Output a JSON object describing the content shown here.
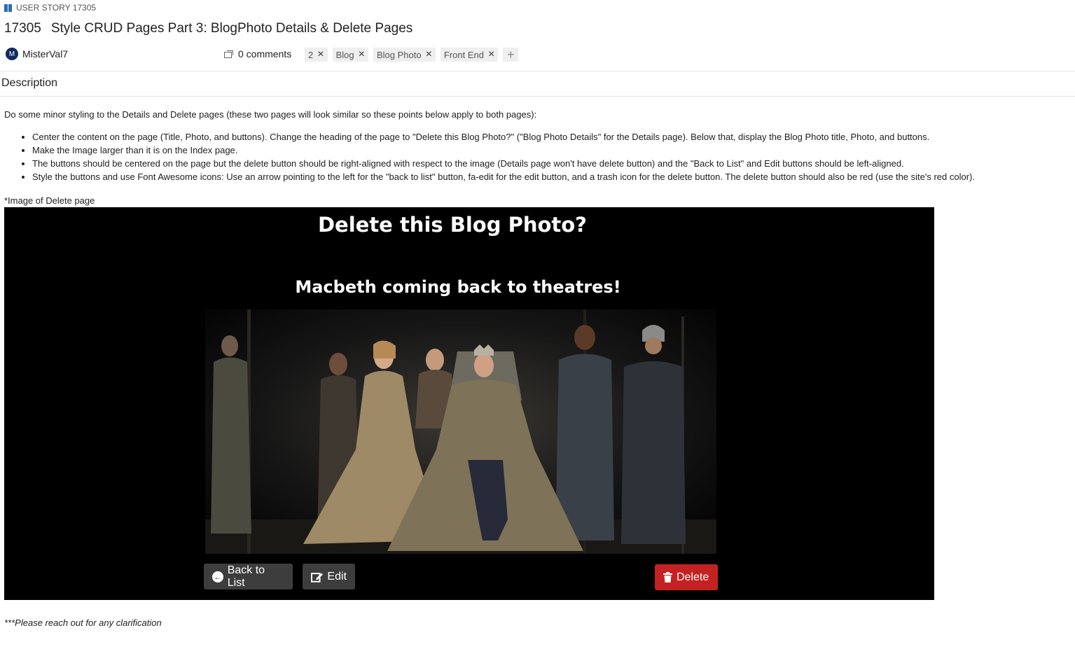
{
  "work_item": {
    "type_label": "USER STORY 17305",
    "id": "17305",
    "title": "Style CRUD Pages Part 3: BlogPhoto Details & Delete Pages",
    "assignee": {
      "initial": "M",
      "name": "MisterVal7"
    },
    "comments_label": "0 comments",
    "tags": [
      "2",
      "Blog",
      "Blog Photo",
      "Front End"
    ],
    "add_tag_label": "+"
  },
  "description": {
    "heading": "Description",
    "intro": "Do some minor styling to the Details and Delete pages (these two pages will look similar so these points below apply to both pages):",
    "bullets": [
      "Center the content on the page (Title, Photo, and buttons).  Change the heading of the page to \"Delete this Blog Photo?\" (\"Blog Photo Details\" for the Details page).  Below that, display the Blog Photo title, Photo, and buttons.",
      "Make the Image larger than it is on the Index page.",
      "The buttons should be centered on the page but the delete button should be right-aligned with respect to the image (Details page won't have delete button) and the \"Back to List\" and Edit buttons should be left-aligned.",
      "Style the buttons and use Font Awesome icons: Use an arrow pointing to the left for the \"back to list\" button, fa-edit for the edit button, and a trash icon for the delete button.  The delete button should also be red (use the site's red color)."
    ],
    "image_caption": "*Image of Delete page",
    "closing_note": "***Please reach out for any clarification"
  },
  "screenshot": {
    "heading": "Delete this Blog Photo?",
    "photo_title": "Macbeth coming back to theatres!",
    "back_label": "Back to List",
    "edit_label": "Edit",
    "delete_label": "Delete",
    "delete_color": "#c42222",
    "button_color": "#3d3d3d"
  }
}
